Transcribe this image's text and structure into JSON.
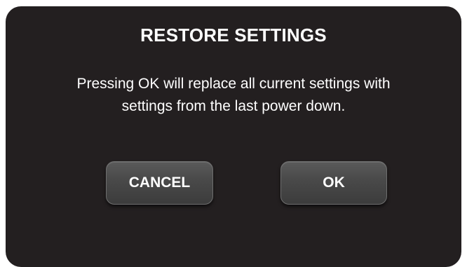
{
  "dialog": {
    "title": "RESTORE SETTINGS",
    "message_line1": "Pressing OK will replace all current settings with",
    "message_line2": "settings from the last power down.",
    "buttons": {
      "cancel_label": "CANCEL",
      "ok_label": "OK"
    },
    "colors": {
      "background": "#231f20",
      "button": "#4a4a4a",
      "text": "#ffffff"
    }
  }
}
